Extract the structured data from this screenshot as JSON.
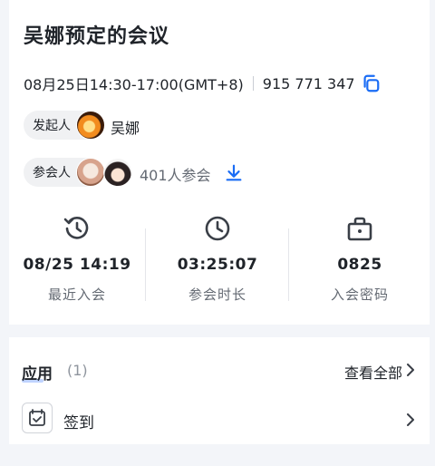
{
  "meeting": {
    "title": "吴娜预定的会议",
    "time": "08月25日14:30-17:00(GMT+8)",
    "meeting_id": "915 771 347"
  },
  "initiator": {
    "label": "发起人",
    "name": "吴娜"
  },
  "attendees": {
    "label": "参会人",
    "count_text": "401人参会"
  },
  "stats": [
    {
      "icon": "history-icon",
      "value": "08/25 14:19",
      "label": "最近入会"
    },
    {
      "icon": "clock-icon",
      "value": "03:25:07",
      "label": "参会时长"
    },
    {
      "icon": "lock-bag-icon",
      "value": "0825",
      "label": "入会密码"
    }
  ],
  "apps": {
    "title": "应用",
    "count": "(1)",
    "view_all": "查看全部",
    "items": [
      {
        "label": "签到",
        "icon": "calendar-check-icon"
      }
    ]
  },
  "colors": {
    "accent": "#1a6cf5",
    "muted": "#646a73"
  }
}
